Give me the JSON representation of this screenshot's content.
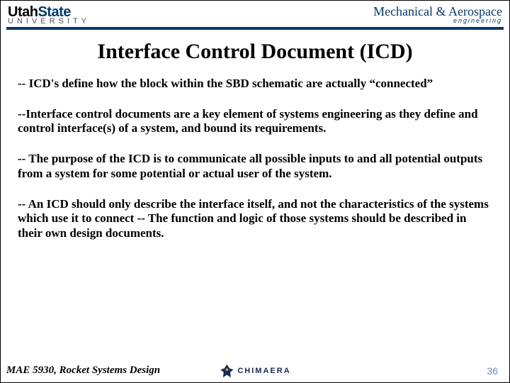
{
  "header": {
    "usu_main": "Utah",
    "usu_state": "State",
    "usu_sub": "UNIVERSITY",
    "mae_main": "Mechanical & Aerospace",
    "mae_sub": "engineering"
  },
  "title": "Interface Control Document (ICD)",
  "paragraphs": [
    "-- ICD's define how the block within the SBD schematic are actually “connected”",
    "--Interface control documents are a key element of systems engineering as they define and control interface(s) of a system, and bound its requirements.",
    "-- The purpose of the ICD is to communicate all possible inputs to and all potential outputs from a system for some potential or actual user of the system.",
    "-- An ICD should only describe the interface itself, and not the characteristics of the systems which use it to connect -- The function and logic of those systems should be described in their own design documents."
  ],
  "footer": {
    "course": "MAE 5930, Rocket Systems Design",
    "center_label": "CHIMAERA",
    "page": "36"
  }
}
